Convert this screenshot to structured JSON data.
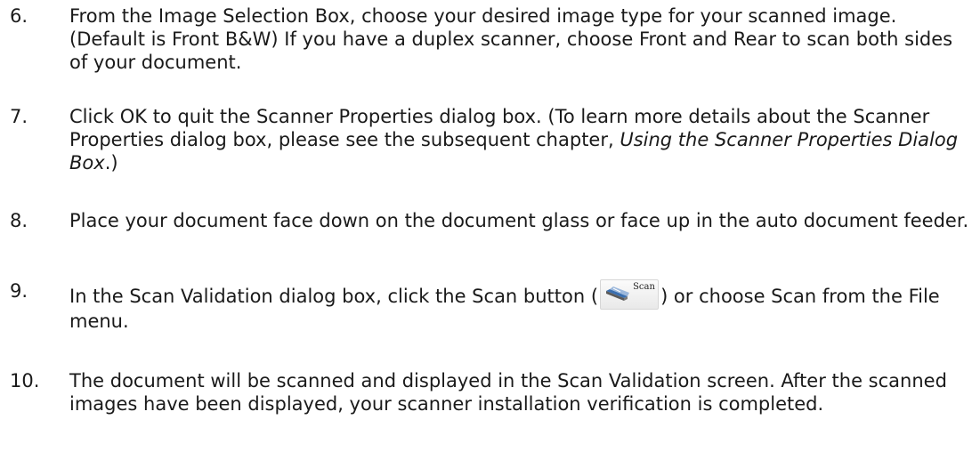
{
  "steps": [
    {
      "number": "6.",
      "text": "From the Image Selection Box, choose your desired image type for your scanned image.   (Default is Front B&W)   If you have a duplex scanner, choose Front and Rear to scan both sides of your document."
    },
    {
      "number": "7.",
      "text_before": "Click OK to quit the Scanner Properties dialog box.   (To learn more details about the Scanner Properties dialog box, please see the subsequent chapter, ",
      "italic": "Using the Scanner Properties Dialog Box",
      "text_after": ".)"
    },
    {
      "number": "8.",
      "text": "Place your document face down on the document glass or face up in the auto document feeder."
    },
    {
      "number": "9.",
      "text_before": "In the Scan Validation dialog box, click the Scan button (",
      "button_label": "Scan",
      "button_icon": "scanner-icon",
      "text_after": ") or choose Scan from the File menu."
    },
    {
      "number": "10.",
      "text": "The document will be scanned and displayed in the Scan Validation screen. After the scanned images have been displayed, your scanner installation verification is completed."
    }
  ],
  "colors": {
    "text": "#1a1a1a",
    "button_bg": "#eeeeee",
    "icon_blue": "#3a6fb0"
  }
}
